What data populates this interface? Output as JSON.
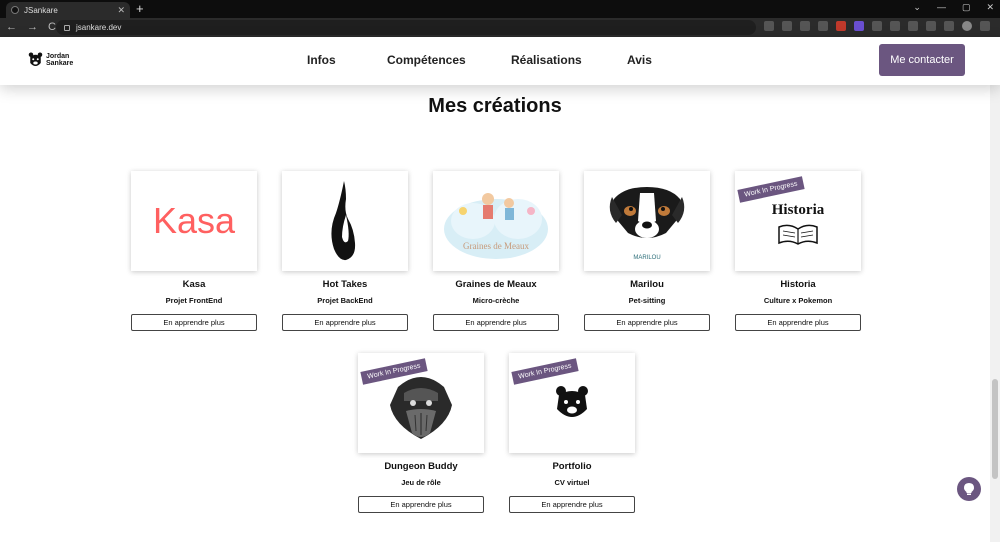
{
  "browser": {
    "tab_title": "JSankare",
    "tab_close": "✕",
    "new_tab": "+",
    "url": "jsankare.dev",
    "back": "←",
    "forward": "→",
    "reload": "C",
    "win_min": "—",
    "win_max": "▢",
    "win_close": "✕",
    "chevron": "⌄"
  },
  "header": {
    "logo_line1": "Jordan",
    "logo_line2": "Sankare",
    "nav": [
      "Infos",
      "Compétences",
      "Réalisations",
      "Avis"
    ],
    "contact_label": "Me contacter"
  },
  "main": {
    "title": "Mes créations",
    "cta_label": "En apprendre plus",
    "wip_label": "Work In Progress",
    "projects": [
      {
        "name": "Kasa",
        "subtitle": "Projet FrontEnd",
        "logo_text": "Kasa",
        "wip": false
      },
      {
        "name": "Hot Takes",
        "subtitle": "Projet BackEnd",
        "wip": false
      },
      {
        "name": "Graines de Meaux",
        "subtitle": "Micro-crèche",
        "logo_text": "Graines de Meaux",
        "wip": false
      },
      {
        "name": "Marilou",
        "subtitle": "Pet-sitting",
        "logo_text": "MARILOU",
        "wip": false
      },
      {
        "name": "Historia",
        "subtitle": "Culture x Pokemon",
        "logo_text": "Historia",
        "wip": true
      },
      {
        "name": "Dungeon Buddy",
        "subtitle": "Jeu de rôle",
        "wip": true
      },
      {
        "name": "Portfolio",
        "subtitle": "CV virtuel",
        "wip": true
      }
    ]
  },
  "colors": {
    "accent": "#6b5680",
    "kasa_red": "#ff6060"
  },
  "icons": [
    "lightbulb-icon",
    "bear-logo-icon",
    "flame-icon",
    "dog-icon",
    "book-icon",
    "dwarf-icon"
  ]
}
